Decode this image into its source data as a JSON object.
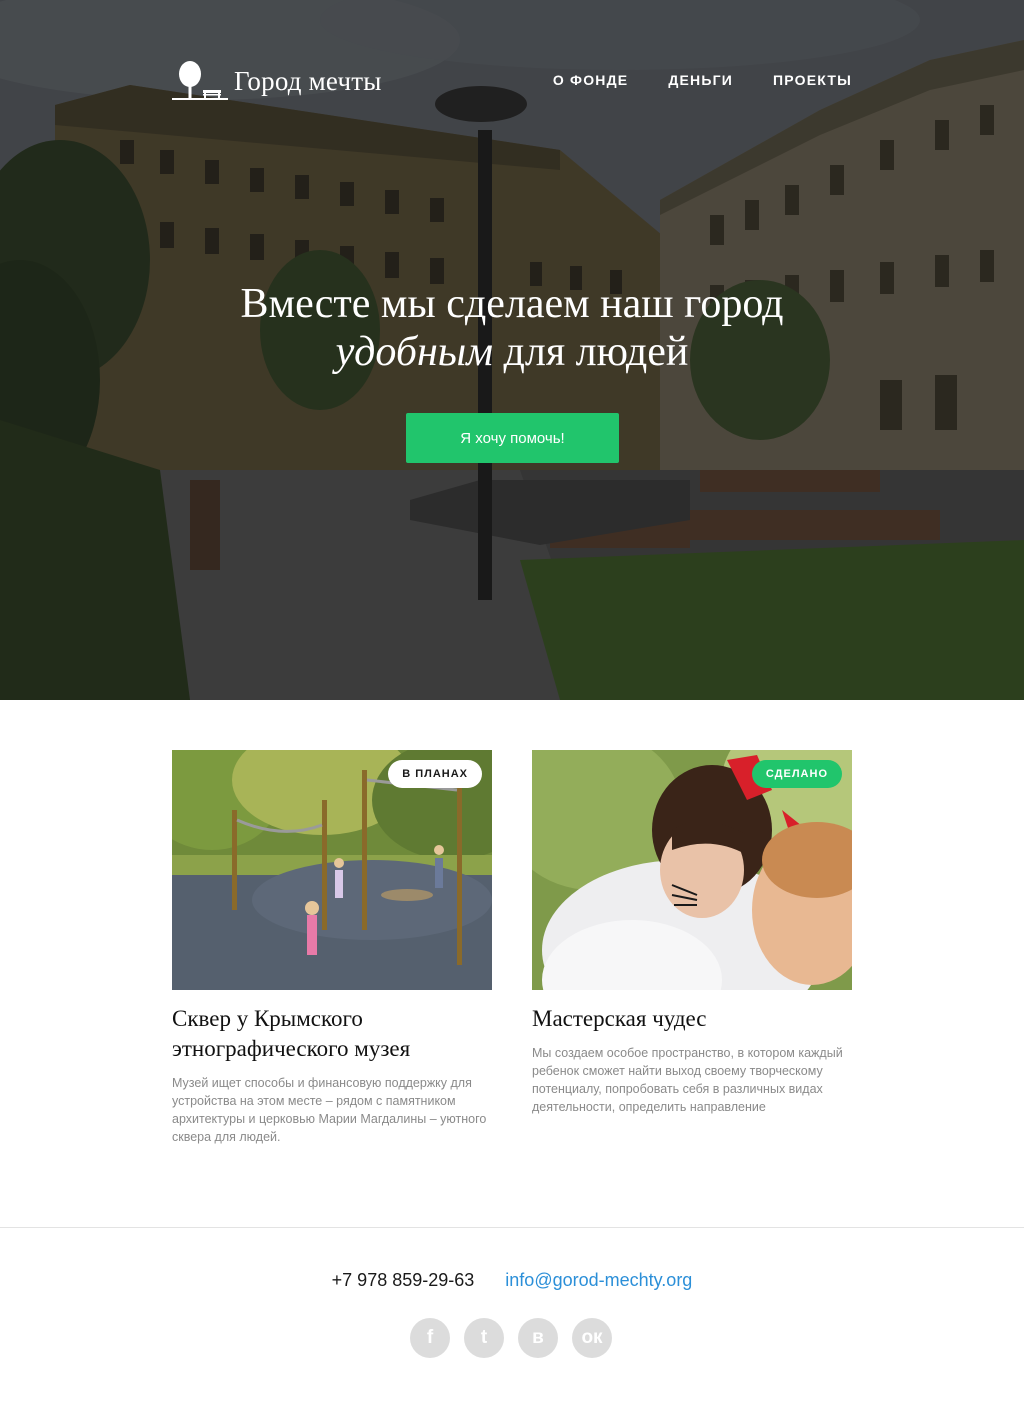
{
  "header": {
    "logo_text": "Город мечты",
    "nav": [
      "О ФОНДЕ",
      "ДЕНЬГИ",
      "ПРОЕКТЫ"
    ]
  },
  "hero": {
    "title_line1": "Вместе мы сделаем наш город",
    "title_italic": "удобным",
    "title_rest": " для людей",
    "cta_label": "Я хочу помочь!",
    "accent_color": "#21c56c"
  },
  "projects": [
    {
      "status": "В ПЛАНАХ",
      "title": "Сквер у Крымского этнографического музея",
      "description": "Музей ищет способы и финансовую поддержку для устройства на этом месте – рядом с памятником архитектуры и церковью Марии Магдалины – уютного сквера для людей."
    },
    {
      "status": "СДЕЛАНО",
      "title": "Мастерская чудес",
      "description": "Мы создаем особое пространство, в котором каждый ребенок сможет найти выход своему творческому потенциалу, попробовать себя в различных видах деятельности, определить направление"
    }
  ],
  "footer": {
    "phone": "+7 978 859-29-63",
    "email": "info@gorod-mechty.org",
    "email_color": "#2b8fd8",
    "socials": [
      {
        "icon": "facebook-icon",
        "glyph": "f"
      },
      {
        "icon": "twitter-icon",
        "glyph": "t"
      },
      {
        "icon": "vk-icon",
        "glyph": "в"
      },
      {
        "icon": "odnoklassniki-icon",
        "glyph": "ок"
      }
    ]
  }
}
